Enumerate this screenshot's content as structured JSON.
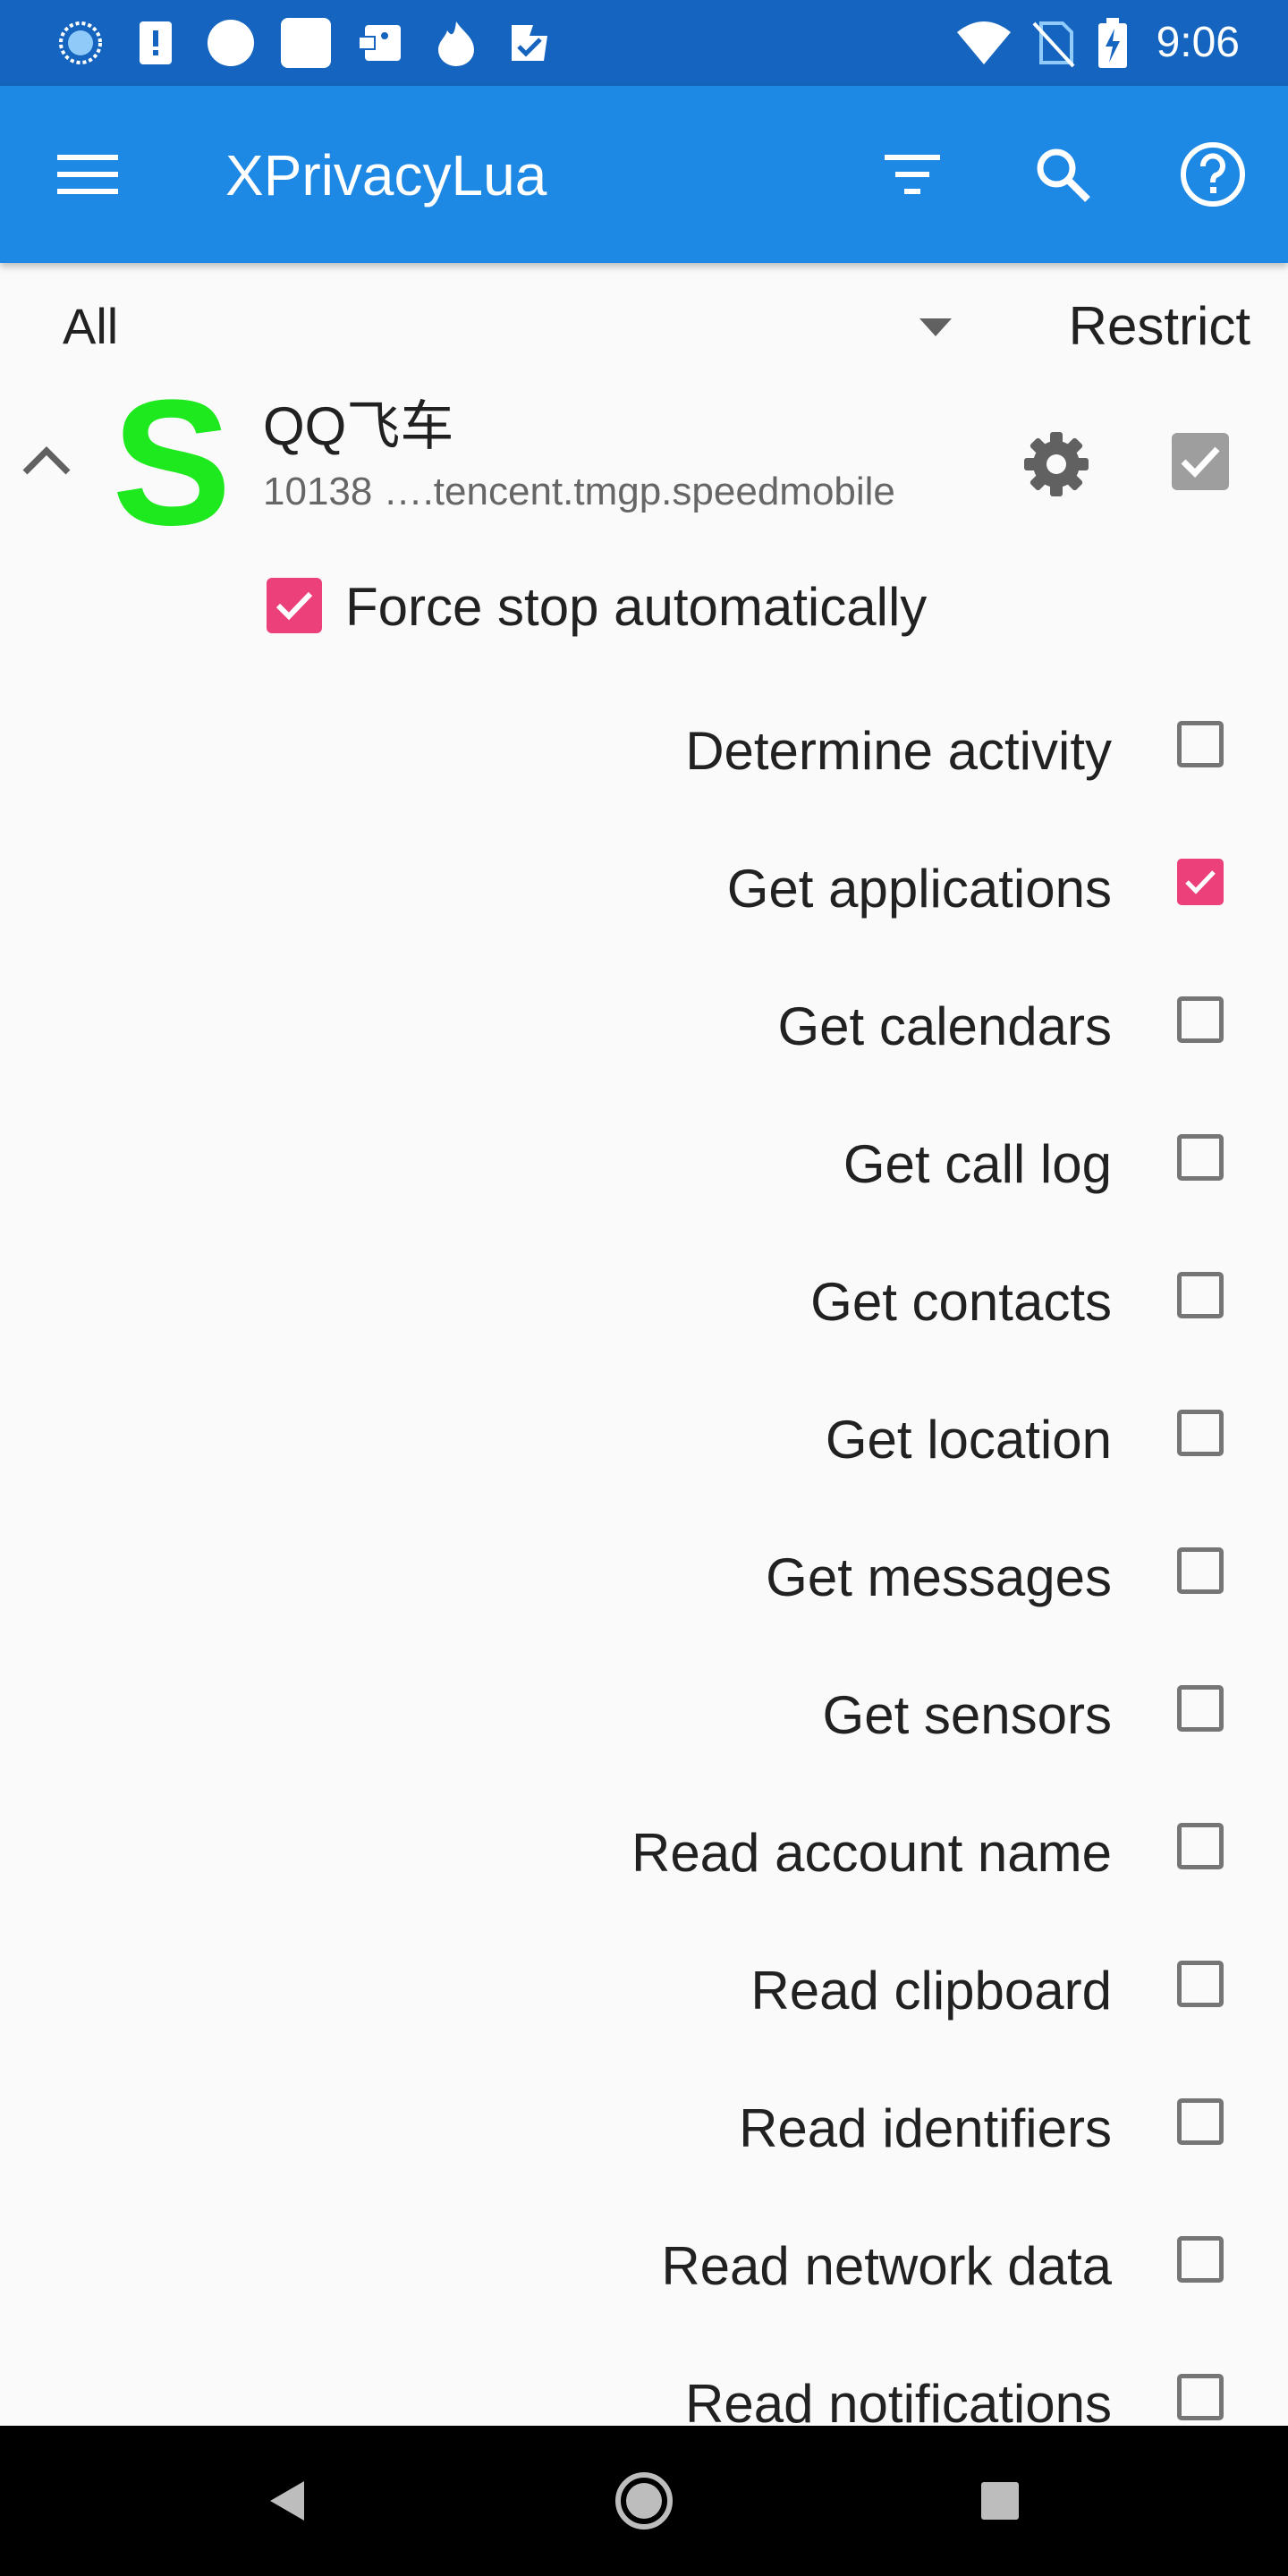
{
  "status_bar": {
    "time": "9:06",
    "icons_left": [
      "spinner-icon",
      "alert-icon",
      "circle-icon",
      "square-icon",
      "notification-icon",
      "fire-icon",
      "check-flag-icon"
    ],
    "icons_right": [
      "wifi-icon",
      "no-sim-icon",
      "battery-charging-icon"
    ]
  },
  "app_bar": {
    "title": "XPrivacyLua",
    "buttons": [
      "menu-icon",
      "filter-icon",
      "search-icon",
      "help-icon"
    ]
  },
  "filter": {
    "selected": "All",
    "restrict_label": "Restrict"
  },
  "app": {
    "icon_letter": "S",
    "icon_color": "#1ee81e",
    "name": "QQ飞车",
    "package": "10138 ….tencent.tmgp.speedmobile",
    "restricted": true
  },
  "force_stop": {
    "label": "Force stop automatically",
    "checked": true
  },
  "restrictions": [
    {
      "label": "Determine activity",
      "checked": false
    },
    {
      "label": "Get applications",
      "checked": true
    },
    {
      "label": "Get calendars",
      "checked": false
    },
    {
      "label": "Get call log",
      "checked": false
    },
    {
      "label": "Get contacts",
      "checked": false
    },
    {
      "label": "Get location",
      "checked": false
    },
    {
      "label": "Get messages",
      "checked": false
    },
    {
      "label": "Get sensors",
      "checked": false
    },
    {
      "label": "Read account name",
      "checked": false
    },
    {
      "label": "Read clipboard",
      "checked": false
    },
    {
      "label": "Read identifiers",
      "checked": false
    },
    {
      "label": "Read network data",
      "checked": false
    },
    {
      "label": "Read notifications",
      "checked": false
    }
  ],
  "colors": {
    "status_bar": "#1565c0",
    "app_bar": "#1e88e5",
    "accent": "#ec407a",
    "background": "#fafafa"
  },
  "nav_bar": {
    "buttons": [
      "back-icon",
      "home-icon",
      "recents-icon"
    ]
  }
}
